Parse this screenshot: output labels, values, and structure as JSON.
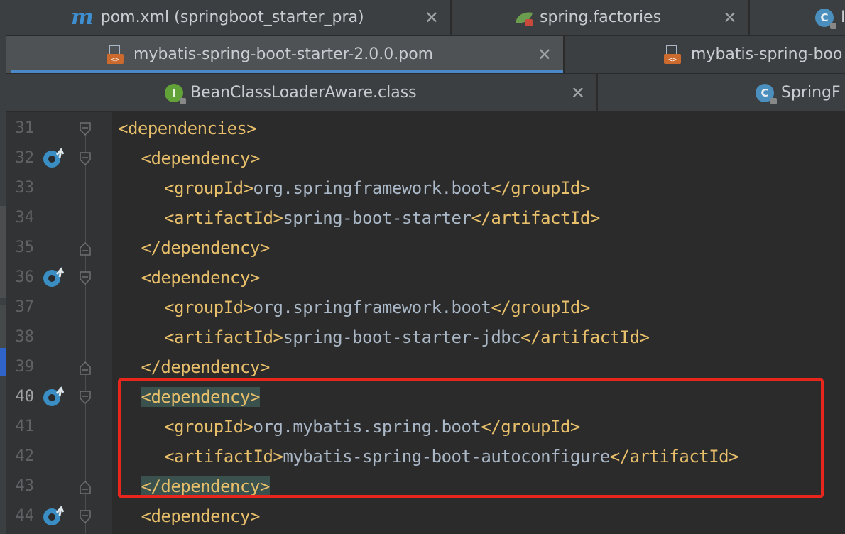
{
  "tabs_row1": [
    {
      "icon": "maven-m-icon",
      "label": "pom.xml (springboot_starter_pra)",
      "close": "✕"
    },
    {
      "icon": "spring-leaf-icon",
      "label": "spring.factories",
      "close": "✕"
    },
    {
      "icon": "class-c-icon",
      "label": "I"
    }
  ],
  "tabs_row2": [
    {
      "icon": "pom-file-icon",
      "label": "mybatis-spring-boot-starter-2.0.0.pom",
      "close": "✕",
      "active": true
    },
    {
      "icon": "pom-file-icon",
      "label": "mybatis-spring-boo"
    }
  ],
  "tabs_row3": [
    {
      "icon": "interface-i-icon",
      "label": "BeanClassLoaderAware.class",
      "close": "✕",
      "icon_letter": "I"
    },
    {
      "icon": "class-c-icon",
      "label": "SpringF",
      "icon_letter": "C"
    }
  ],
  "editor": {
    "current_line": 40,
    "lines": [
      {
        "num": "31",
        "indent": 0,
        "open": "<dependencies>",
        "text": "",
        "close": ""
      },
      {
        "num": "32",
        "indent": 1,
        "open": "<dependency>",
        "text": "",
        "close": "",
        "override": true
      },
      {
        "num": "33",
        "indent": 2,
        "open": "<groupId>",
        "text": "org.springframework.boot",
        "close": "</groupId>"
      },
      {
        "num": "34",
        "indent": 2,
        "open": "<artifactId>",
        "text": "spring-boot-starter",
        "close": "</artifactId>"
      },
      {
        "num": "35",
        "indent": 1,
        "open": "</dependency>",
        "text": "",
        "close": ""
      },
      {
        "num": "36",
        "indent": 1,
        "open": "<dependency>",
        "text": "",
        "close": "",
        "override": true
      },
      {
        "num": "37",
        "indent": 2,
        "open": "<groupId>",
        "text": "org.springframework.boot",
        "close": "</groupId>"
      },
      {
        "num": "38",
        "indent": 2,
        "open": "<artifactId>",
        "text": "spring-boot-starter-jdbc",
        "close": "</artifactId>"
      },
      {
        "num": "39",
        "indent": 1,
        "open": "</dependency>",
        "text": "",
        "close": ""
      },
      {
        "num": "40",
        "indent": 1,
        "open": "<dependency>",
        "text": "",
        "close": "",
        "override": true,
        "highlight": true
      },
      {
        "num": "41",
        "indent": 2,
        "open": "<groupId>",
        "text": "org.mybatis.spring.boot",
        "close": "</groupId>"
      },
      {
        "num": "42",
        "indent": 2,
        "open": "<artifactId>",
        "text": "mybatis-spring-boot-autoconfigure",
        "close": "</artifactId>"
      },
      {
        "num": "43",
        "indent": 1,
        "open": "</dependency>",
        "text": "",
        "close": "",
        "highlight": true
      },
      {
        "num": "44",
        "indent": 1,
        "open": "<dependency>",
        "text": "",
        "close": "",
        "override": true
      }
    ]
  },
  "colors": {
    "tag": "#e8bf6a",
    "text": "#a9b7c6",
    "annotation_box": "#e8261c",
    "match_highlight": "#3b514d",
    "active_tab_underline": "#4a88c7"
  }
}
